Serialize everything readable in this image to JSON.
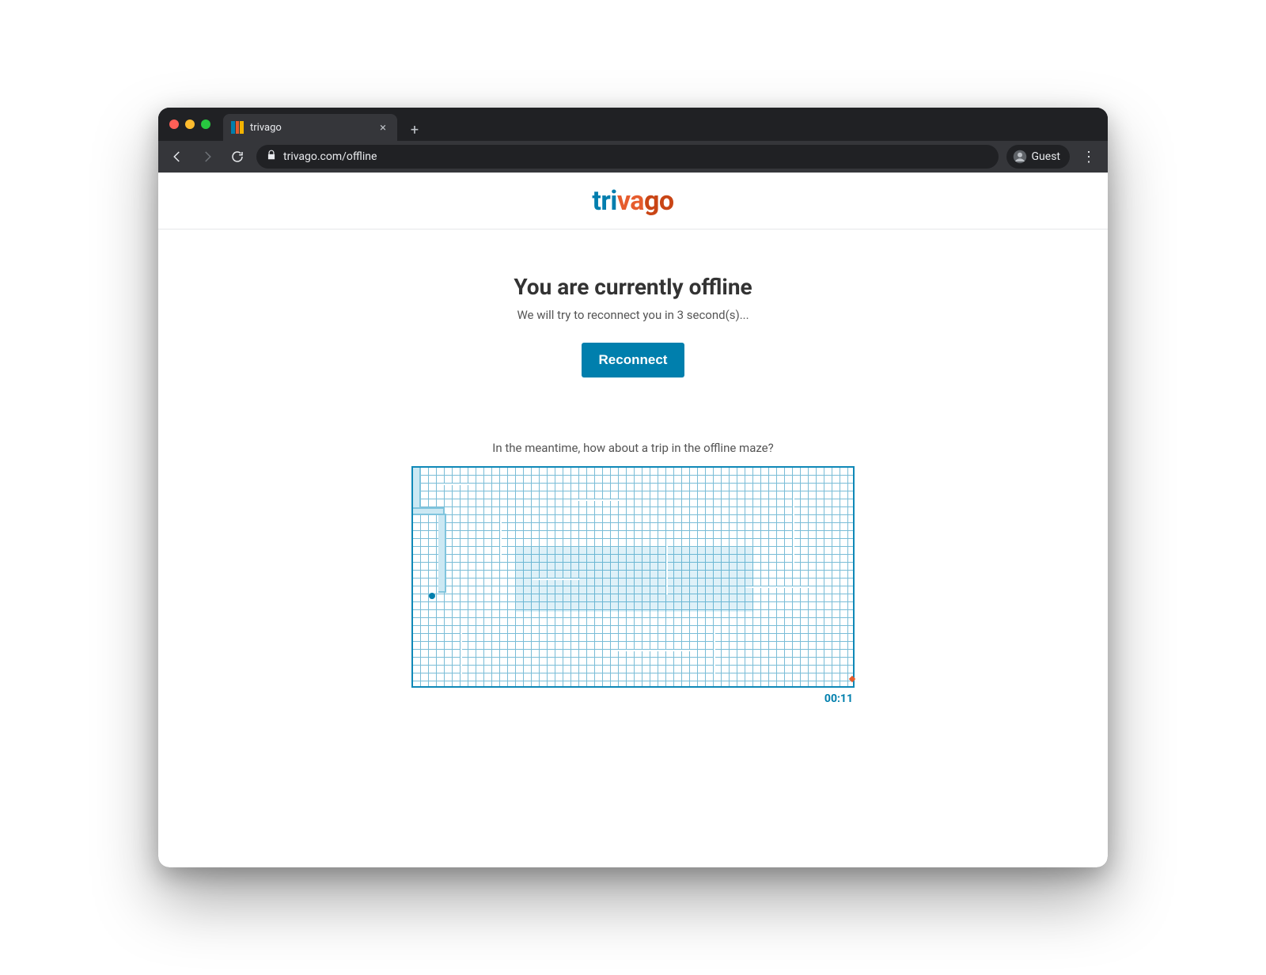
{
  "browser": {
    "tab_title": "trivago",
    "url": "trivago.com/offline",
    "profile_label": "Guest"
  },
  "logo": {
    "part1": "tri",
    "part2": "va",
    "part3": "go"
  },
  "page": {
    "headline": "You are currently offline",
    "sub": "We will try to reconnect you in 3 second(s)...",
    "reconnect_label": "Reconnect",
    "maze_prompt": "In the meantime, how about a trip in the offline maze?",
    "timer": "00:11"
  },
  "colors": {
    "primary": "#007fad",
    "maze_line": "#0f88b7",
    "accent_orange": "#e65c2d"
  }
}
